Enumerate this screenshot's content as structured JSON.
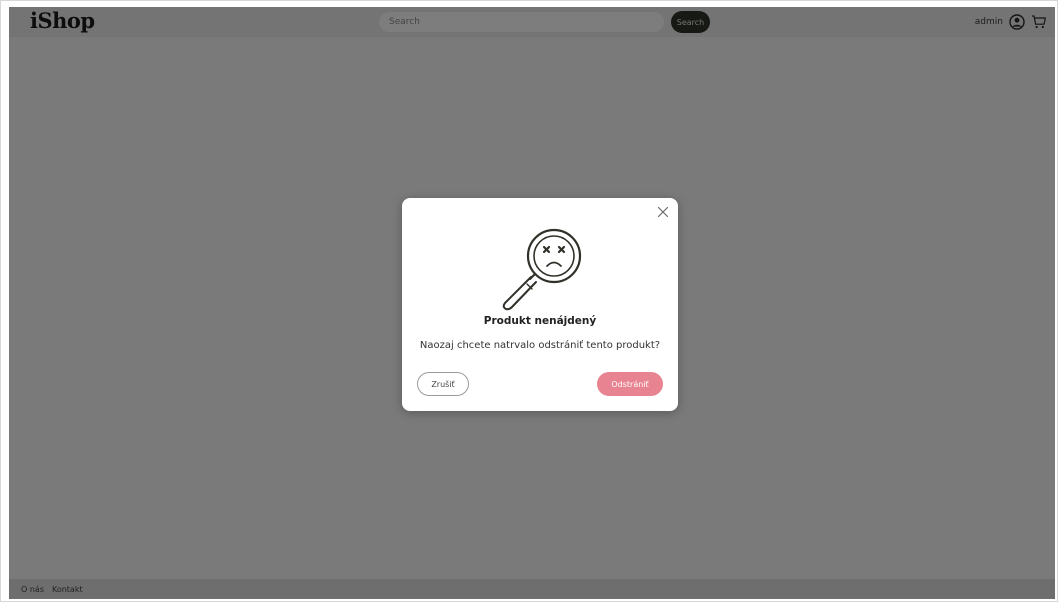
{
  "header": {
    "logo": "iShop",
    "search": {
      "placeholder": "Search",
      "value": ""
    },
    "search_button_label": "Search",
    "username": "admin",
    "icons": {
      "user": "user-circle-icon",
      "cart": "cart-icon"
    }
  },
  "modal": {
    "illustration": "magnifier-sad-face-icon",
    "title": "Produkt nenájdený",
    "message": "Naozaj chcete natrvalo odstrániť tento produkt?",
    "cancel_label": "Zrušiť",
    "delete_label": "Odstrániť",
    "close_icon": "close-icon"
  },
  "footer": {
    "links": [
      "O nás",
      "Kontakt"
    ]
  },
  "colors": {
    "accent_delete": "#e88491",
    "search_button": "#2f3229",
    "overlay": "rgba(0,0,0,0.5)"
  }
}
